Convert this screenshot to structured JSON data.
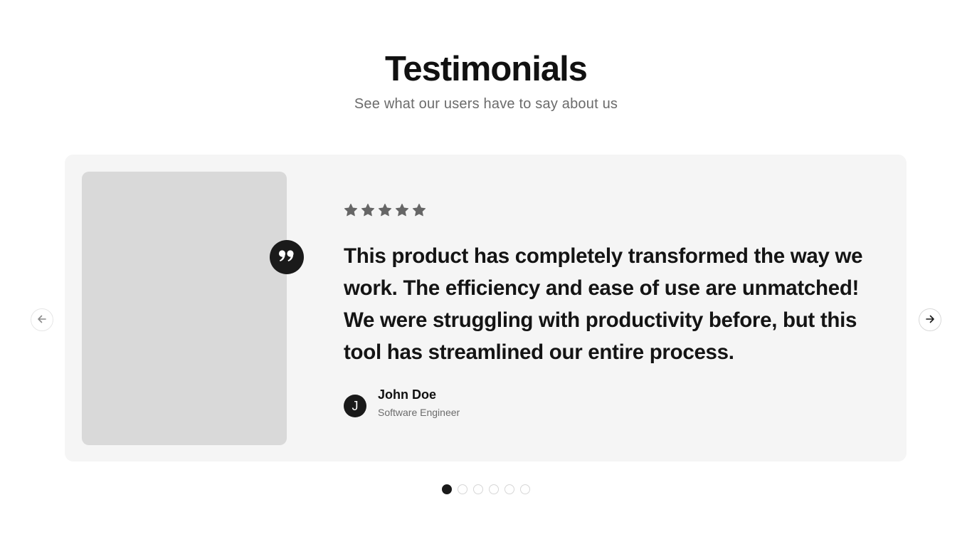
{
  "header": {
    "title": "Testimonials",
    "subtitle": "See what our users have to say about us"
  },
  "testimonial": {
    "rating": 5,
    "max_rating": 5,
    "star_color": "#666666",
    "quote": "This product has completely transformed the way we work. The efficiency and ease of use are unmatched! We were struggling with productivity before, but this tool has streamlined our entire process.",
    "author": {
      "initial": "J",
      "name": "John Doe",
      "role": "Software Engineer"
    }
  },
  "icons": {
    "quote": "quote-icon",
    "star": "star-icon",
    "prev": "arrow-left-icon",
    "next": "arrow-right-icon"
  },
  "carousel": {
    "total_slides": 6,
    "active_index": 0
  },
  "colors": {
    "accent": "#1a1a1a",
    "card_background": "#f5f5f5",
    "photo_placeholder": "#d9d9d9",
    "muted_text": "#6b6b6b"
  }
}
